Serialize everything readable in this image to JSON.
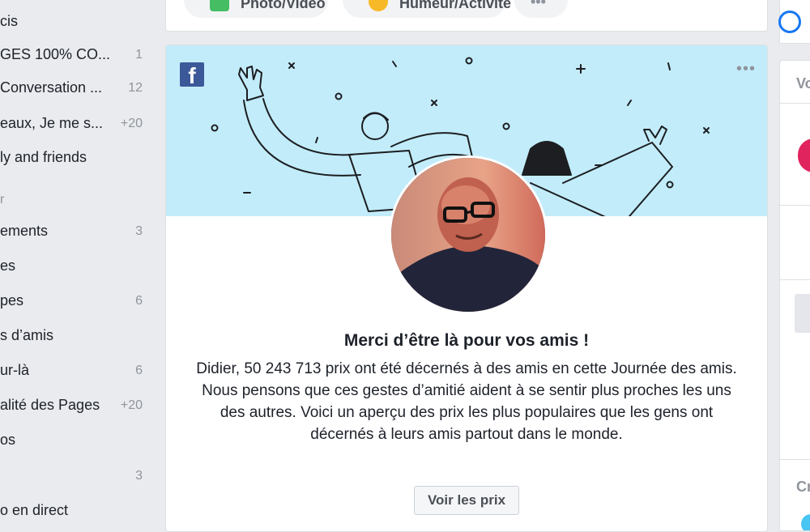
{
  "sidebar": {
    "items": [
      {
        "label": "cis",
        "count": ""
      },
      {
        "label": "GES 100% CO...",
        "count": "1"
      },
      {
        "label": "Conversation ...",
        "count": "12"
      },
      {
        "label": "eaux, Je me s...",
        "count": "+20"
      },
      {
        "label": "ly and friends",
        "count": ""
      },
      {
        "label": "ements",
        "count": "3"
      },
      {
        "label": "es",
        "count": ""
      },
      {
        "label": "pes",
        "count": "6"
      },
      {
        "label": "s d’amis",
        "count": ""
      },
      {
        "label": "ur-là",
        "count": "6"
      },
      {
        "label": "alité des Pages",
        "count": "+20"
      },
      {
        "label": "os",
        "count": ""
      },
      {
        "label": "",
        "count": "3"
      },
      {
        "label": "o en direct",
        "count": ""
      }
    ],
    "section_header": "r"
  },
  "composer": {
    "photo_label": "Photo/Vidéo",
    "mood_label": "Humeur/Activité",
    "more_label": "•••"
  },
  "post": {
    "more_label": "•••",
    "title": "Merci d’être là pour vos amis !",
    "body": "Didier, 50 243 713 prix ont été décernés à des amis en cette Journée des amis. Nous pensons que ces gestes d’amitié aident à se sentir plus proches les uns des autres. Voici un aperçu des prix les plus populaires que les gens ont décernés à leurs amis partout dans le monde.",
    "cta_label": "Voir les prix"
  },
  "right": {
    "card_title": "Vo",
    "card_sub": "Cr"
  },
  "colors": {
    "banner": "#c2ecfa",
    "facebook_blue": "#3b5998",
    "page_bg": "#e9ebee"
  }
}
